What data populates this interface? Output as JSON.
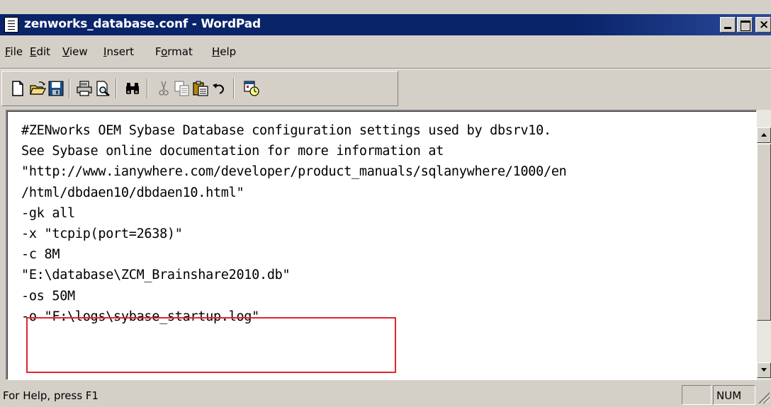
{
  "window": {
    "title": "zenworks_database.conf - WordPad"
  },
  "menu": {
    "file": {
      "u": "F",
      "rest": "ile"
    },
    "edit": {
      "u": "E",
      "rest": "dit"
    },
    "view": {
      "u": "V",
      "rest": "iew"
    },
    "insert": {
      "u": "I",
      "rest": "nsert"
    },
    "format": {
      "pre": "F",
      "u": "o",
      "rest": "rmat"
    },
    "help": {
      "u": "H",
      "rest": "elp"
    }
  },
  "toolbar": {
    "icons": [
      "new-document-icon",
      "open-folder-icon",
      "save-disk-icon",
      "print-icon",
      "print-preview-icon",
      "find-binoculars-icon",
      "cut-scissors-icon",
      "copy-icon",
      "paste-icon",
      "undo-icon",
      "insert-date-time-icon"
    ]
  },
  "editor": {
    "lines": [
      "#ZENworks OEM Sybase Database configuration settings used by dbsrv10.",
      "See Sybase online documentation for more information at",
      "\"http://www.ianywhere.com/developer/product_manuals/sqlanywhere/1000/en",
      "/html/dbdaen10/dbdaen10.html\"",
      "-gk all",
      "-x \"tcpip(port=2638)\"",
      "-c 8M",
      "\"E:\\database\\ZCM_Brainshare2010.db\"",
      "-os 50M",
      "-o \"F:\\logs\\sybase_startup.log\""
    ],
    "highlight_color": "#e0252f"
  },
  "statusbar": {
    "help_text": "For Help, press F1",
    "num_indicator": "NUM"
  },
  "colors": {
    "titlebar": "#0a246a",
    "chrome": "#d4d0c8"
  }
}
